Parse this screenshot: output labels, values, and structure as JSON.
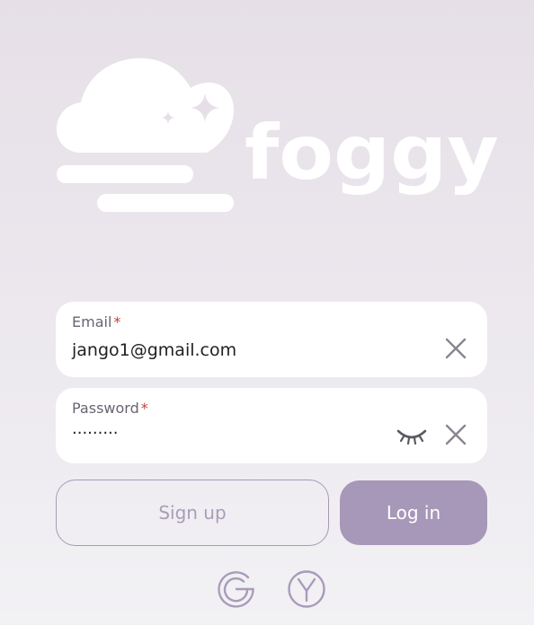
{
  "app": {
    "name": "foggy"
  },
  "login_form": {
    "email": {
      "label": "Email",
      "required_mark": "*",
      "value": "jango1@gmail.com"
    },
    "password": {
      "label": "Password",
      "required_mark": "*",
      "value": "·········"
    }
  },
  "buttons": {
    "signup_label": "Sign up",
    "login_label": "Log in"
  },
  "social": [
    "google-icon",
    "yandex-icon"
  ],
  "colors": {
    "accent": "#a797b8",
    "outline": "#a799b6",
    "required": "#c0413b",
    "background_top": "#e6dfe7",
    "background_bottom": "#f2f1f4"
  }
}
